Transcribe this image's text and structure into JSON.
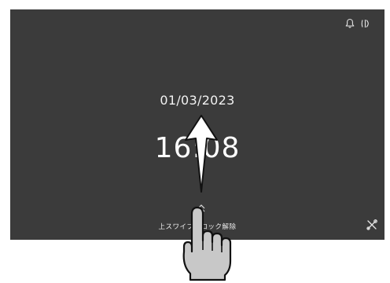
{
  "lock_screen": {
    "date": "01/03/2023",
    "time": "16:08",
    "swipe_hint": "上スワイプでロック解除"
  },
  "status_bar": {
    "icons": [
      "bell-icon",
      "screen-mode-icon"
    ]
  },
  "corner_tool_icon": "tools-icon",
  "overlay": {
    "arrow": "swipe-up-arrow",
    "hand": "pointing-hand-icon"
  },
  "colors": {
    "screen_background": "#3b3b3b",
    "text": "#ffffff",
    "hand_fill": "#c8c8c8"
  }
}
